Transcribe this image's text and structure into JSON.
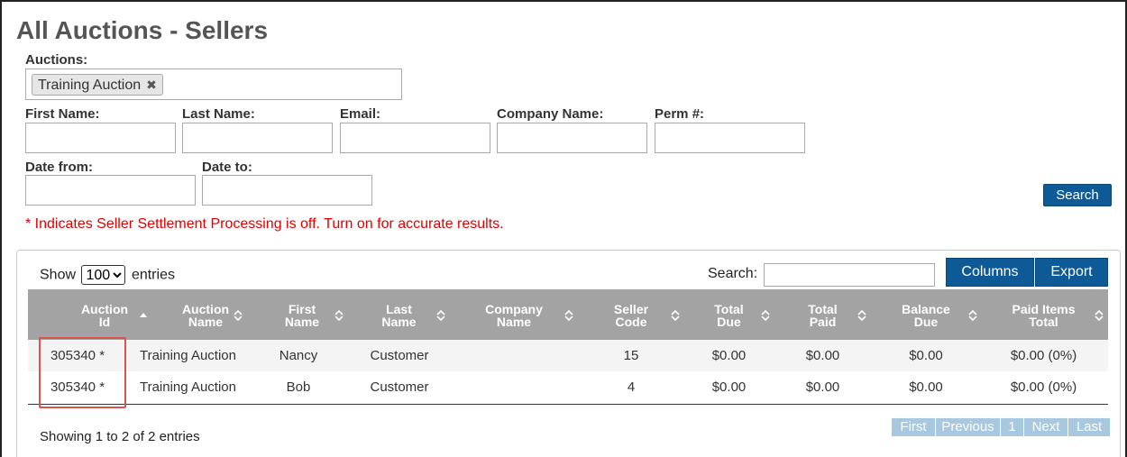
{
  "page": {
    "title": "All Auctions - Sellers"
  },
  "filters": {
    "auctions_label": "Auctions:",
    "selected_auction": "Training Auction",
    "remove_glyph": "✖",
    "first_name_label": "First Name:",
    "last_name_label": "Last Name:",
    "email_label": "Email:",
    "company_label": "Company Name:",
    "perm_label": "Perm #:",
    "date_from_label": "Date from:",
    "date_to_label": "Date to:",
    "search_button": "Search"
  },
  "notice": "* Indicates Seller Settlement Processing is off. Turn on for accurate results.",
  "table_controls": {
    "show_label": "Show",
    "entries_label": "entries",
    "page_size": "100",
    "search_label": "Search:",
    "columns_button": "Columns",
    "export_button": "Export"
  },
  "table": {
    "headers": [
      {
        "line1": "Auction",
        "line2": "Id",
        "sort": "asc"
      },
      {
        "line1": "Auction",
        "line2": "Name",
        "sort": "both"
      },
      {
        "line1": "First",
        "line2": "Name",
        "sort": "both"
      },
      {
        "line1": "Last",
        "line2": "Name",
        "sort": "both"
      },
      {
        "line1": "Company",
        "line2": "Name",
        "sort": "both"
      },
      {
        "line1": "Seller",
        "line2": "Code",
        "sort": "both"
      },
      {
        "line1": "Total",
        "line2": "Due",
        "sort": "both"
      },
      {
        "line1": "Total",
        "line2": "Paid",
        "sort": "both"
      },
      {
        "line1": "Balance",
        "line2": "Due",
        "sort": "both"
      },
      {
        "line1": "Paid Items",
        "line2": "Total",
        "sort": "both"
      }
    ],
    "rows": [
      [
        "305340 *",
        "Training Auction",
        "Nancy",
        "Customer",
        "",
        "15",
        "$0.00",
        "$0.00",
        "$0.00",
        "$0.00 (0%)"
      ],
      [
        "305340 *",
        "Training Auction",
        "Bob",
        "Customer",
        "",
        "4",
        "$0.00",
        "$0.00",
        "$0.00",
        "$0.00 (0%)"
      ]
    ]
  },
  "footer": {
    "info": "Showing 1 to 2 of 2 entries",
    "pager": {
      "first": "First",
      "previous": "Previous",
      "page": "1",
      "next": "Next",
      "last": "Last"
    }
  },
  "colors": {
    "primary": "#0d5a96",
    "notice": "#e00000",
    "header": "#a3a3a3",
    "highlight": "#d9534f",
    "pager": "#a8c8e0"
  }
}
